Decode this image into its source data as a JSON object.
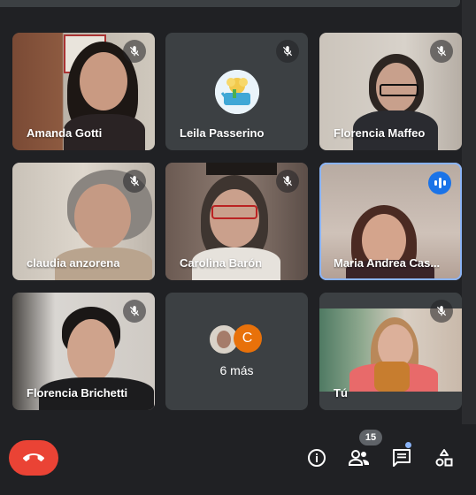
{
  "participants": [
    {
      "name": "Amanda Gotti",
      "muted": true
    },
    {
      "name": "Leila Passerino",
      "muted": true
    },
    {
      "name": "Florencia Maffeo",
      "muted": true
    },
    {
      "name": "claudia anzorena",
      "muted": true
    },
    {
      "name": "Carolina Barón",
      "muted": true
    },
    {
      "name": "Maria Andrea Cas...",
      "muted": false,
      "speaking": true
    },
    {
      "name": "Florencia Brichetti",
      "muted": true
    },
    {
      "name": "Tú",
      "muted": true
    }
  ],
  "more_tile": {
    "avatar_letter": "C",
    "label": "6 más"
  },
  "controls": {
    "participant_count": "15",
    "icons": [
      "end-call-icon",
      "info-icon",
      "people-icon",
      "chat-icon",
      "activities-icon"
    ]
  },
  "colors": {
    "speaking_accent": "#1a73e8",
    "leave_red": "#ea4335",
    "tile_bg": "#3c4043"
  }
}
